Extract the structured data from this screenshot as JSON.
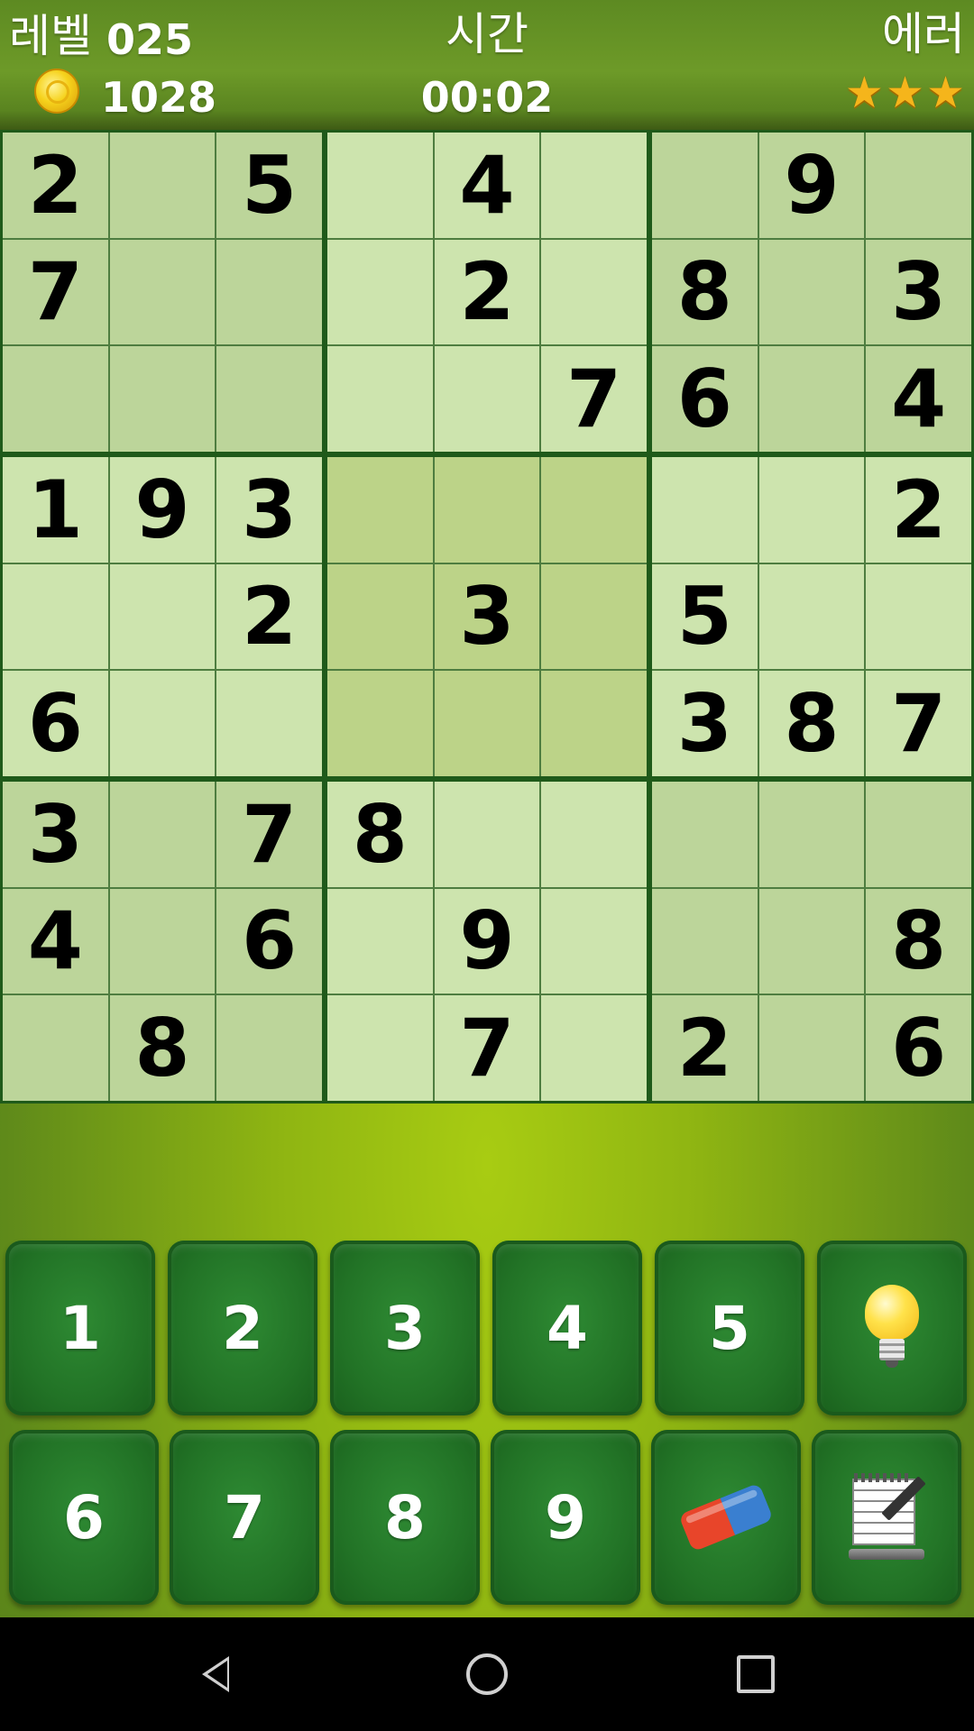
{
  "header": {
    "level_label": "레벨",
    "level_value": "025",
    "time_label": "시간",
    "time_value": "00:02",
    "error_label": "에러",
    "coins": "1028",
    "stars": [
      "★",
      "★",
      "★"
    ],
    "coin_icon": "coin-icon",
    "star_icon": "star-icon"
  },
  "board": {
    "rows": [
      [
        "2",
        "",
        "5",
        "",
        "4",
        "",
        "",
        "9",
        ""
      ],
      [
        "7",
        "",
        "",
        "",
        "2",
        "",
        "8",
        "",
        "3"
      ],
      [
        "",
        "",
        "",
        "",
        "",
        "7",
        "6",
        "",
        "4"
      ],
      [
        "1",
        "9",
        "3",
        "",
        "",
        "",
        "",
        "",
        "2"
      ],
      [
        "",
        "",
        "2",
        "",
        "3",
        "",
        "5",
        "",
        ""
      ],
      [
        "6",
        "",
        "",
        "",
        "",
        "",
        "3",
        "8",
        "7"
      ],
      [
        "3",
        "",
        "7",
        "8",
        "",
        "",
        "",
        "",
        ""
      ],
      [
        "4",
        "",
        "6",
        "",
        "9",
        "",
        "",
        "",
        "8"
      ],
      [
        "",
        "8",
        "",
        "",
        "7",
        "",
        "2",
        "",
        "6"
      ]
    ]
  },
  "keypad": {
    "row1": [
      "1",
      "2",
      "3",
      "4",
      "5"
    ],
    "row2": [
      "6",
      "7",
      "8",
      "9"
    ],
    "hint_icon": "lightbulb-icon",
    "erase_icon": "eraser-icon",
    "notes_icon": "notepad-pencil-icon"
  },
  "navbar": {
    "back_icon": "back-triangle-icon",
    "home_icon": "home-circle-icon",
    "recent_icon": "recents-square-icon"
  },
  "colors": {
    "cell_dark": "#bcd59a",
    "cell_light": "#cde4ae",
    "grid_line": "#1f5a1a",
    "key_green": "#227326",
    "star": "#f5b51b"
  }
}
